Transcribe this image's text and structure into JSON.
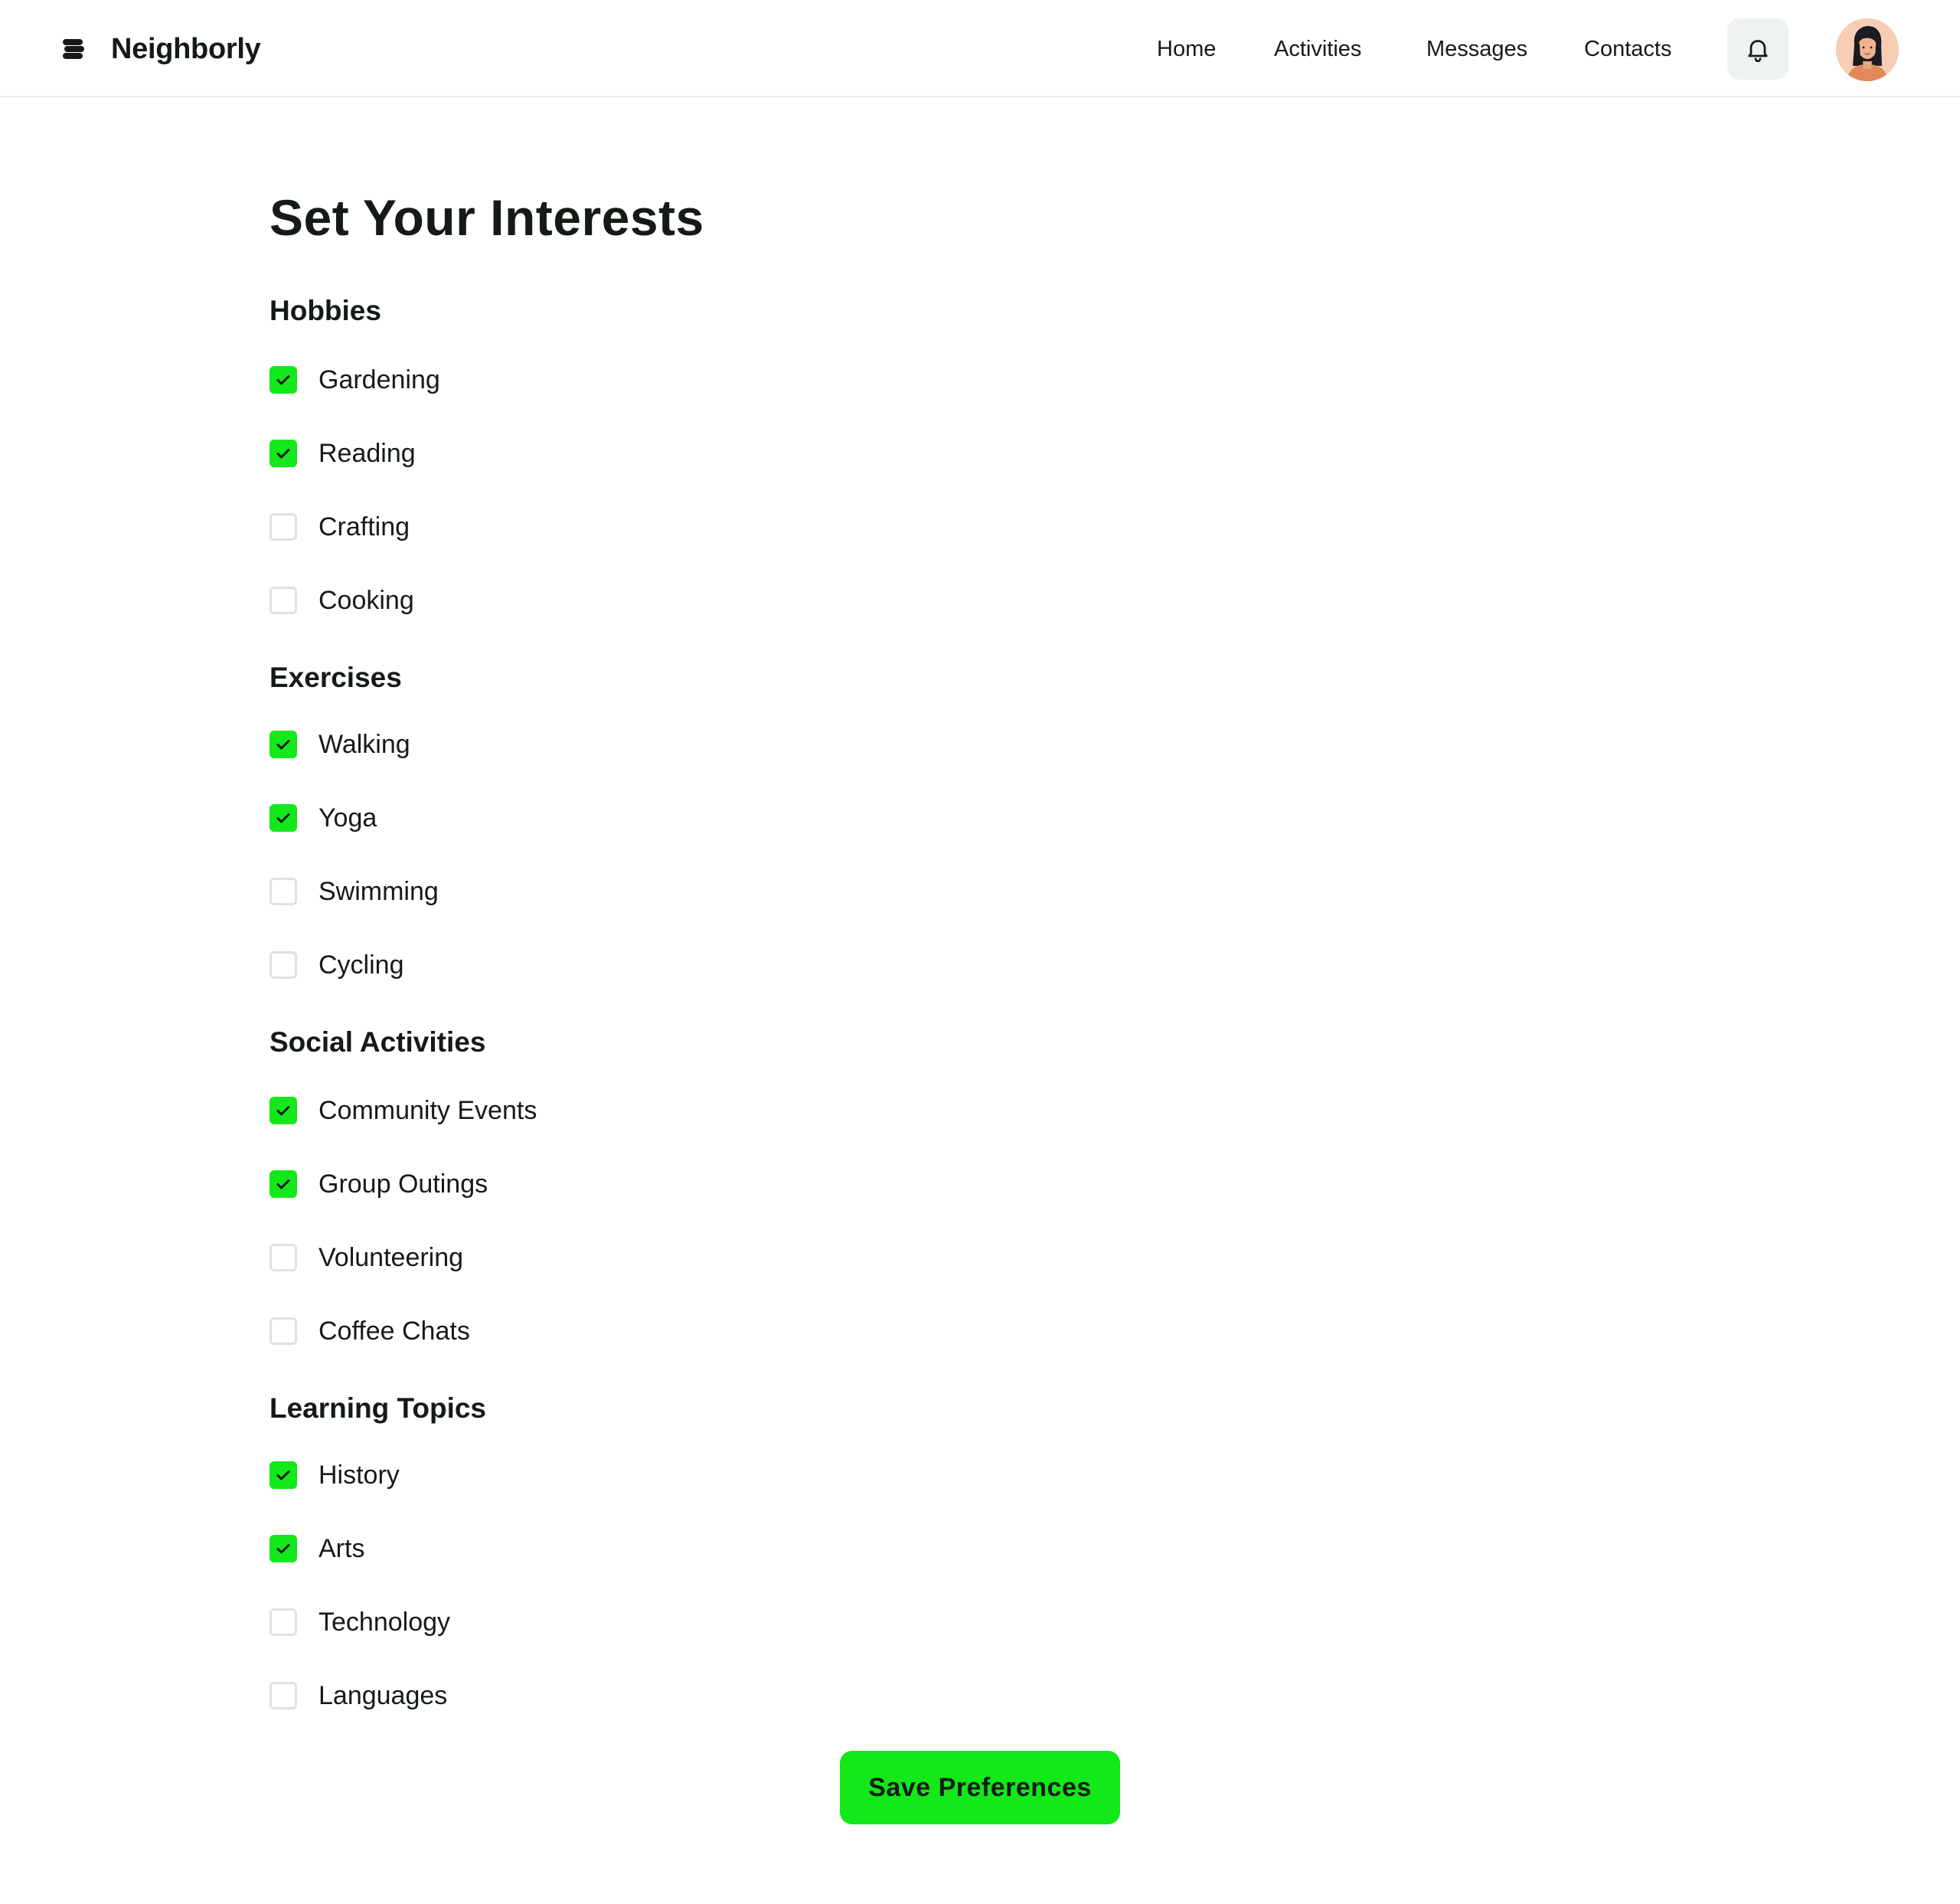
{
  "header": {
    "brand": "Neighborly",
    "nav": [
      "Home",
      "Activities",
      "Messages",
      "Contacts"
    ],
    "notifications_icon": "bell-icon",
    "avatar_icon": "user-avatar"
  },
  "page": {
    "title": "Set Your Interests"
  },
  "sections": [
    {
      "title": "Hobbies",
      "options": [
        {
          "label": "Gardening",
          "checked": true
        },
        {
          "label": "Reading",
          "checked": true
        },
        {
          "label": "Crafting",
          "checked": false
        },
        {
          "label": "Cooking",
          "checked": false
        }
      ]
    },
    {
      "title": "Exercises",
      "options": [
        {
          "label": "Walking",
          "checked": true
        },
        {
          "label": "Yoga",
          "checked": true
        },
        {
          "label": "Swimming",
          "checked": false
        },
        {
          "label": "Cycling",
          "checked": false
        }
      ]
    },
    {
      "title": "Social Activities",
      "options": [
        {
          "label": "Community Events",
          "checked": true
        },
        {
          "label": "Group Outings",
          "checked": true
        },
        {
          "label": "Volunteering",
          "checked": false
        },
        {
          "label": "Coffee Chats",
          "checked": false
        }
      ]
    },
    {
      "title": "Learning Topics",
      "options": [
        {
          "label": "History",
          "checked": true
        },
        {
          "label": "Arts",
          "checked": true
        },
        {
          "label": "Technology",
          "checked": false
        },
        {
          "label": "Languages",
          "checked": false
        }
      ]
    }
  ],
  "actions": {
    "save_label": "Save Preferences"
  },
  "colors": {
    "accent": "#13e81a",
    "text": "#141b14",
    "checkbox_border": "#dde3dd",
    "bell_bg": "#eef3f0",
    "avatar_bg": "#f7cdb5"
  }
}
